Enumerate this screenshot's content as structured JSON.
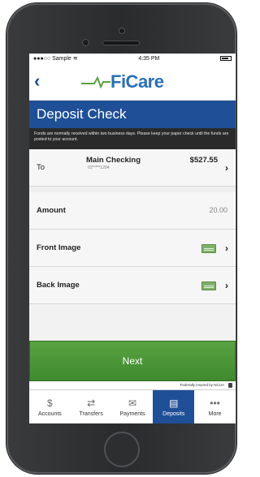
{
  "status_bar": {
    "carrier": "●●●○○ Sample",
    "wifi_icon": "wifi-icon",
    "time": "4:35 PM",
    "battery_icon": "battery-icon"
  },
  "header": {
    "logo_text": "FiCare",
    "back_icon": "chevron-left-icon"
  },
  "page": {
    "title": "Deposit Check",
    "notice": "Funds are normally received within two business days. Please keep your paper check until the funds are posted to your account."
  },
  "form": {
    "to": {
      "label": "To",
      "account_name": "Main Checking",
      "account_number": "01*****1204",
      "balance": "$527.55"
    },
    "amount": {
      "label": "Amount",
      "value": "20.00"
    },
    "front_image": {
      "label": "Front Image"
    },
    "back_image": {
      "label": "Back Image"
    }
  },
  "actions": {
    "next_label": "Next"
  },
  "footer": {
    "ncua_text": "Federally insured by NCUA"
  },
  "tabs": [
    {
      "label": "Accounts",
      "icon": "dollar-icon",
      "glyph": "$",
      "active": false
    },
    {
      "label": "Transfers",
      "icon": "transfer-icon",
      "glyph": "⇄",
      "active": false
    },
    {
      "label": "Payments",
      "icon": "payments-icon",
      "glyph": "✉",
      "active": false
    },
    {
      "label": "Deposits",
      "icon": "deposit-icon",
      "glyph": "▤",
      "active": true
    },
    {
      "label": "More",
      "icon": "more-icon",
      "glyph": "•••",
      "active": false
    }
  ],
  "colors": {
    "brand_blue": "#1f4f96",
    "logo_blue": "#2a6fb5",
    "next_green": "#4c9a38"
  }
}
